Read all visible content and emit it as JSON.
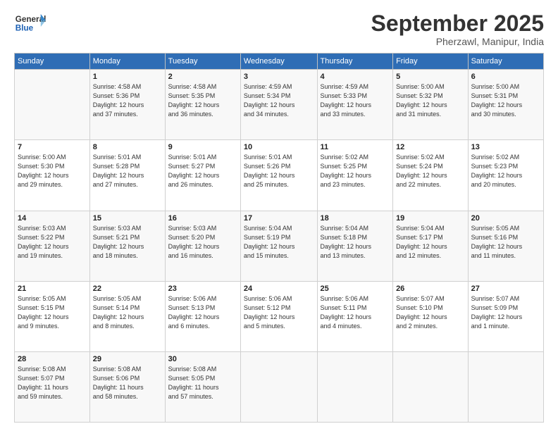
{
  "header": {
    "logo_general": "General",
    "logo_blue": "Blue",
    "month_title": "September 2025",
    "location": "Pherzawl, Manipur, India"
  },
  "days_of_week": [
    "Sunday",
    "Monday",
    "Tuesday",
    "Wednesday",
    "Thursday",
    "Friday",
    "Saturday"
  ],
  "weeks": [
    [
      {
        "day": "",
        "info": ""
      },
      {
        "day": "1",
        "info": "Sunrise: 4:58 AM\nSunset: 5:36 PM\nDaylight: 12 hours\nand 37 minutes."
      },
      {
        "day": "2",
        "info": "Sunrise: 4:58 AM\nSunset: 5:35 PM\nDaylight: 12 hours\nand 36 minutes."
      },
      {
        "day": "3",
        "info": "Sunrise: 4:59 AM\nSunset: 5:34 PM\nDaylight: 12 hours\nand 34 minutes."
      },
      {
        "day": "4",
        "info": "Sunrise: 4:59 AM\nSunset: 5:33 PM\nDaylight: 12 hours\nand 33 minutes."
      },
      {
        "day": "5",
        "info": "Sunrise: 5:00 AM\nSunset: 5:32 PM\nDaylight: 12 hours\nand 31 minutes."
      },
      {
        "day": "6",
        "info": "Sunrise: 5:00 AM\nSunset: 5:31 PM\nDaylight: 12 hours\nand 30 minutes."
      }
    ],
    [
      {
        "day": "7",
        "info": "Sunrise: 5:00 AM\nSunset: 5:30 PM\nDaylight: 12 hours\nand 29 minutes."
      },
      {
        "day": "8",
        "info": "Sunrise: 5:01 AM\nSunset: 5:28 PM\nDaylight: 12 hours\nand 27 minutes."
      },
      {
        "day": "9",
        "info": "Sunrise: 5:01 AM\nSunset: 5:27 PM\nDaylight: 12 hours\nand 26 minutes."
      },
      {
        "day": "10",
        "info": "Sunrise: 5:01 AM\nSunset: 5:26 PM\nDaylight: 12 hours\nand 25 minutes."
      },
      {
        "day": "11",
        "info": "Sunrise: 5:02 AM\nSunset: 5:25 PM\nDaylight: 12 hours\nand 23 minutes."
      },
      {
        "day": "12",
        "info": "Sunrise: 5:02 AM\nSunset: 5:24 PM\nDaylight: 12 hours\nand 22 minutes."
      },
      {
        "day": "13",
        "info": "Sunrise: 5:02 AM\nSunset: 5:23 PM\nDaylight: 12 hours\nand 20 minutes."
      }
    ],
    [
      {
        "day": "14",
        "info": "Sunrise: 5:03 AM\nSunset: 5:22 PM\nDaylight: 12 hours\nand 19 minutes."
      },
      {
        "day": "15",
        "info": "Sunrise: 5:03 AM\nSunset: 5:21 PM\nDaylight: 12 hours\nand 18 minutes."
      },
      {
        "day": "16",
        "info": "Sunrise: 5:03 AM\nSunset: 5:20 PM\nDaylight: 12 hours\nand 16 minutes."
      },
      {
        "day": "17",
        "info": "Sunrise: 5:04 AM\nSunset: 5:19 PM\nDaylight: 12 hours\nand 15 minutes."
      },
      {
        "day": "18",
        "info": "Sunrise: 5:04 AM\nSunset: 5:18 PM\nDaylight: 12 hours\nand 13 minutes."
      },
      {
        "day": "19",
        "info": "Sunrise: 5:04 AM\nSunset: 5:17 PM\nDaylight: 12 hours\nand 12 minutes."
      },
      {
        "day": "20",
        "info": "Sunrise: 5:05 AM\nSunset: 5:16 PM\nDaylight: 12 hours\nand 11 minutes."
      }
    ],
    [
      {
        "day": "21",
        "info": "Sunrise: 5:05 AM\nSunset: 5:15 PM\nDaylight: 12 hours\nand 9 minutes."
      },
      {
        "day": "22",
        "info": "Sunrise: 5:05 AM\nSunset: 5:14 PM\nDaylight: 12 hours\nand 8 minutes."
      },
      {
        "day": "23",
        "info": "Sunrise: 5:06 AM\nSunset: 5:13 PM\nDaylight: 12 hours\nand 6 minutes."
      },
      {
        "day": "24",
        "info": "Sunrise: 5:06 AM\nSunset: 5:12 PM\nDaylight: 12 hours\nand 5 minutes."
      },
      {
        "day": "25",
        "info": "Sunrise: 5:06 AM\nSunset: 5:11 PM\nDaylight: 12 hours\nand 4 minutes."
      },
      {
        "day": "26",
        "info": "Sunrise: 5:07 AM\nSunset: 5:10 PM\nDaylight: 12 hours\nand 2 minutes."
      },
      {
        "day": "27",
        "info": "Sunrise: 5:07 AM\nSunset: 5:09 PM\nDaylight: 12 hours\nand 1 minute."
      }
    ],
    [
      {
        "day": "28",
        "info": "Sunrise: 5:08 AM\nSunset: 5:07 PM\nDaylight: 11 hours\nand 59 minutes."
      },
      {
        "day": "29",
        "info": "Sunrise: 5:08 AM\nSunset: 5:06 PM\nDaylight: 11 hours\nand 58 minutes."
      },
      {
        "day": "30",
        "info": "Sunrise: 5:08 AM\nSunset: 5:05 PM\nDaylight: 11 hours\nand 57 minutes."
      },
      {
        "day": "",
        "info": ""
      },
      {
        "day": "",
        "info": ""
      },
      {
        "day": "",
        "info": ""
      },
      {
        "day": "",
        "info": ""
      }
    ]
  ]
}
